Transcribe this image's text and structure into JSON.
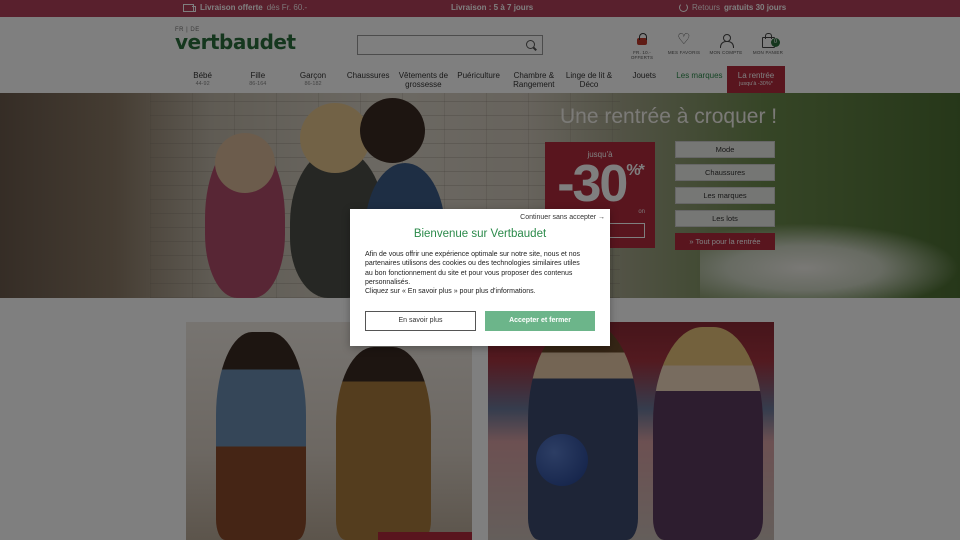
{
  "topbar": {
    "left_bold": "Livraison offerte",
    "left_light": "dès Fr. 60.-",
    "center_label": "Livraison : 5 à 7 jours",
    "right_light": "Retours",
    "right_bold": "gratuits 30 jours"
  },
  "header": {
    "lang": "FR | DE",
    "logo": "vertbaudet",
    "search_placeholder": "",
    "icons": [
      {
        "name": "lock-icon",
        "label": "FR. 10.- OFFERTS"
      },
      {
        "name": "heart-icon",
        "label": "MES FAVORIS"
      },
      {
        "name": "user-icon",
        "label": "MON COMPTE"
      },
      {
        "name": "bag-icon",
        "label": "MON PANIER"
      }
    ],
    "cart_count": "0"
  },
  "nav": {
    "items": [
      {
        "label": "Bébé",
        "sub": "44-92"
      },
      {
        "label": "Fille",
        "sub": "86-164"
      },
      {
        "label": "Garçon",
        "sub": "86-182"
      },
      {
        "label": "Chaussures",
        "sub": ""
      },
      {
        "label": "Vêtements de grossesse",
        "sub": ""
      },
      {
        "label": "Puériculture",
        "sub": ""
      },
      {
        "label": "Chambre & Rangement",
        "sub": ""
      },
      {
        "label": "Linge de lit & Déco",
        "sub": ""
      },
      {
        "label": "Jouets",
        "sub": ""
      },
      {
        "label": "Les marques",
        "sub": ""
      },
      {
        "label": "La rentrée",
        "sub": "jusqu'à -30%*"
      }
    ]
  },
  "hero": {
    "title": "Une rentrée à croquer !",
    "promo_up": "jusqu'à",
    "promo_value": "-30",
    "promo_symbol": "%",
    "promo_star": "*",
    "promo_sub": "on",
    "buttons": [
      "Mode",
      "Chaussures",
      "Les marques",
      "Les lots"
    ],
    "cta": "» Tout pour la rentrée"
  },
  "modal": {
    "continue": "Continuer sans accepter →",
    "title": "Bienvenue sur Vertbaudet",
    "text_lines": [
      "Afin de vous offrir une expérience optimale sur notre site, nous et nos",
      "partenaires utilisons des cookies ou des technologies similaires utiles",
      "au bon fonctionnement du site et pour vous proposer des contenus",
      "personnalisés.",
      "Cliquez sur « En savoir plus » pour plus d'informations."
    ],
    "btn_more": "En savoir plus",
    "btn_accept": "Accepter et fermer"
  },
  "colors": {
    "brand_green": "#2b6e3c",
    "promo_red": "#b22a3d",
    "topbar": "#b3405a",
    "accept_green": "#6cb58a"
  }
}
